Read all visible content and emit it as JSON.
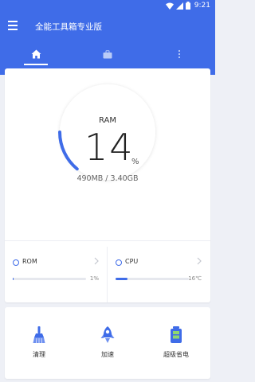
{
  "status": {
    "time": "9:21"
  },
  "app": {
    "title": "全能工具箱专业版"
  },
  "ram": {
    "title": "RAM",
    "percent": "14",
    "percent_sign": "%",
    "detail": "490MB / 3.40GB",
    "usage_fraction": 0.14
  },
  "stats": {
    "rom": {
      "label": "ROM",
      "value": "1%",
      "fraction": 0.01
    },
    "cpu": {
      "label": "CPU",
      "value": "16℃",
      "fraction": 0.16
    }
  },
  "tools": [
    {
      "label": "清理",
      "icon": "broom-icon"
    },
    {
      "label": "加速",
      "icon": "rocket-icon"
    },
    {
      "label": "超级省电",
      "icon": "battery-icon"
    }
  ],
  "colors": {
    "primary": "#3f6ce8",
    "background": "#eef0f6",
    "card": "#ffffff"
  }
}
